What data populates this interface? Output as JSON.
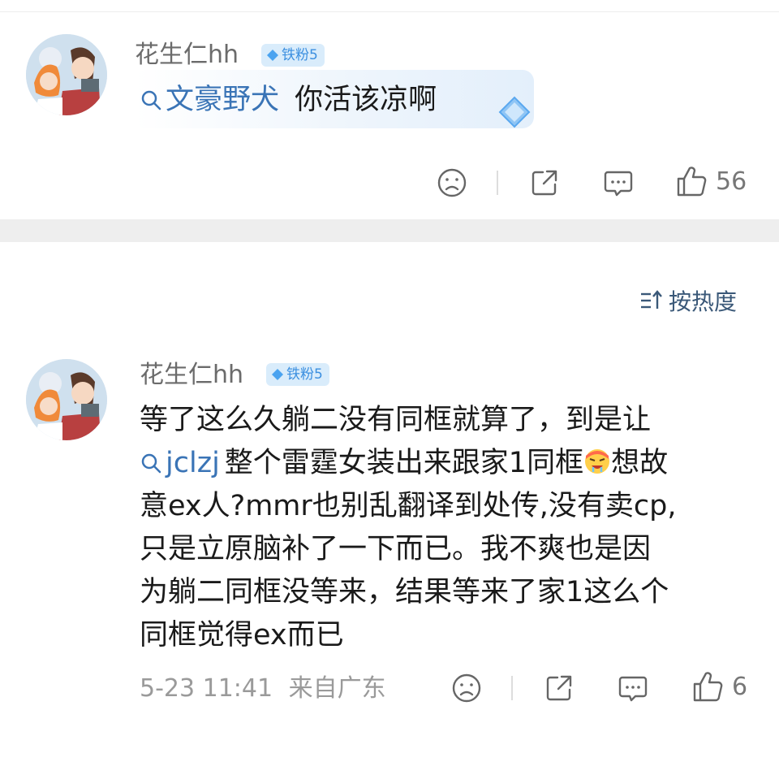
{
  "post1": {
    "username": "花生仁hh",
    "badge": "铁粉5",
    "mention": "文豪野犬",
    "text": "你活该凉啊",
    "like_count": "56"
  },
  "sort": {
    "label": "按热度"
  },
  "post2": {
    "username": "花生仁hh",
    "badge": "铁粉5",
    "lines": [
      "等了这么久躺二没有同框就算了，到是让",
      "想故",
      "意ex人?mmr也别乱翻译到处传,没有卖cp,",
      "只是立原脑补了一下而已。我不爽也是因",
      "为躺二同框没等来，结果等来了家1这么个",
      "同框觉得ex而已"
    ],
    "mention": "jclzj",
    "line2_text": "整个雷霆女装出来跟家1同框",
    "timestamp": "5-23 11:41",
    "location": "来自广东",
    "like_count": "6"
  },
  "colors": {
    "link": "#3a74b6",
    "badge_bg": "#d9ecfb",
    "badge_text": "#3b8fe0",
    "separator": "#eeeeee"
  },
  "icons": [
    "magnifier-icon",
    "sad-face-icon",
    "share-icon",
    "comment-icon",
    "thumbs-up-icon",
    "sort-icon",
    "diamond-icon",
    "hot-face-emoji"
  ]
}
